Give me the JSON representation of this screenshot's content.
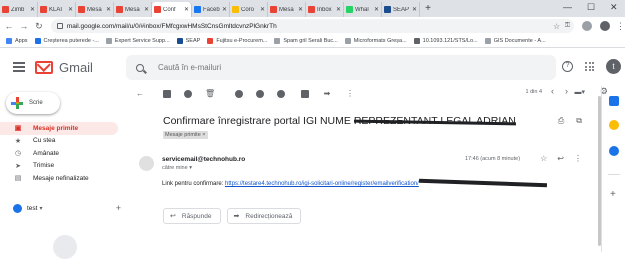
{
  "browser": {
    "tabs": [
      {
        "label": "Zimb",
        "favicon_color": "#ea4335"
      },
      {
        "label": "KLAI",
        "favicon_color": "#ea4335"
      },
      {
        "label": "Mesa",
        "favicon_color": "#ea4335"
      },
      {
        "label": "Mesa",
        "favicon_color": "#ea4335"
      },
      {
        "label": "Conf",
        "favicon_color": "#ea4335",
        "active": true
      },
      {
        "label": "Faceb",
        "favicon_color": "#1877f2"
      },
      {
        "label": "Coro",
        "favicon_color": "#fbbc04"
      },
      {
        "label": "Mesa",
        "favicon_color": "#ea4335"
      },
      {
        "label": "Inbox",
        "favicon_color": "#ea4335"
      },
      {
        "label": "Whal",
        "favicon_color": "#25d366"
      },
      {
        "label": "SEAP",
        "favicon_color": "#1a4d8f"
      }
    ],
    "new_tab": "+",
    "url": "mail.google.com/mail/u/0/#inbox/FMfcgxwHMsStCnsGmltdcvnzPlGnkrTh",
    "bookmarks": [
      {
        "label": "Apps",
        "color": "#4285f4"
      },
      {
        "label": "Creșterea puterede -...",
        "color": "#1a73e8"
      },
      {
        "label": "Expert Service Supp...",
        "color": "#9aa0a6"
      },
      {
        "label": "SEAP",
        "color": "#1a4d8f"
      },
      {
        "label": "Fujitsu e-Procurem...",
        "color": "#ea4335"
      },
      {
        "label": "Spam gril Serali Buc...",
        "color": "#9aa0a6"
      },
      {
        "label": "Microformats Greșa...",
        "color": "#9aa0a6"
      },
      {
        "label": "10.1093.121/STS/Lo...",
        "color": "#5f6368"
      },
      {
        "label": "GIS Documente - A...",
        "color": "#9aa0a6"
      }
    ]
  },
  "gmail": {
    "app_name": "Gmail",
    "search_placeholder": "Caută în e-mailuri",
    "avatar_letter": "t",
    "compose_label": "Scrie",
    "nav": [
      {
        "label": "Mesaje primite",
        "icon": "inbox-icon",
        "glyph": "▣",
        "active": true
      },
      {
        "label": "Cu stea",
        "icon": "star-icon",
        "glyph": "★"
      },
      {
        "label": "Amânate",
        "icon": "clock-icon",
        "glyph": "◷"
      },
      {
        "label": "Trimise",
        "icon": "send-icon",
        "glyph": "➤"
      },
      {
        "label": "Mesaje nefinalizate",
        "icon": "draft-icon",
        "glyph": "▤"
      }
    ],
    "hangouts_user": "test",
    "pager": "1 din 4",
    "message": {
      "subject_visible": "Confirmare înregistrare portal IGI NUME ",
      "subject_struck": "REPREZENTANT LEGAL ADRIAN",
      "label_chip": "Mesaje primite ×",
      "sender": "servicemail@technohub.ro",
      "to": "către mine",
      "date": "17:46 (acum 8 minute)",
      "body_prefix": "Link pentru confirmare: ",
      "link": "https://testare4.technohub.ro/igi-solicitari-online/register/emailverification/"
    },
    "reply_label": "Răspunde",
    "forward_label": "Redirecționează",
    "accent": "#d93025",
    "link_color": "#1155cc"
  }
}
